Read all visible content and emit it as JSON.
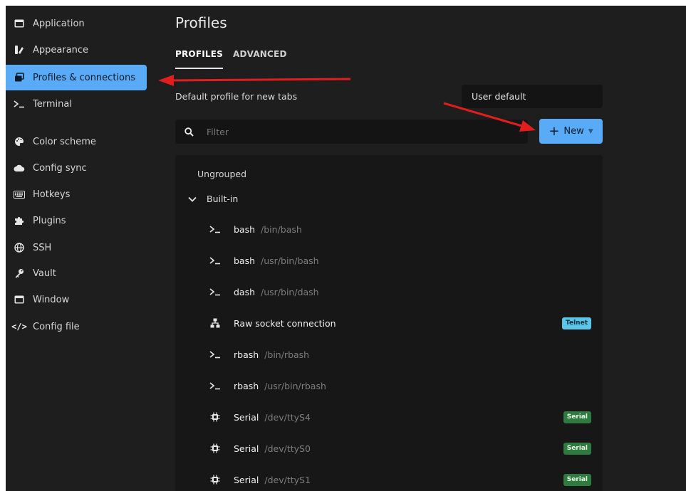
{
  "sidebar": {
    "items": [
      {
        "label": "Application",
        "icon": "window-icon"
      },
      {
        "label": "Appearance",
        "icon": "palette-swatch-icon"
      },
      {
        "label": "Profiles & connections",
        "icon": "window-restore-icon"
      },
      {
        "label": "Terminal",
        "icon": "terminal-icon"
      },
      {
        "label": "Color scheme",
        "icon": "palette-icon"
      },
      {
        "label": "Config sync",
        "icon": "cloud-icon"
      },
      {
        "label": "Hotkeys",
        "icon": "keyboard-icon"
      },
      {
        "label": "Plugins",
        "icon": "puzzle-icon"
      },
      {
        "label": "SSH",
        "icon": "globe-icon"
      },
      {
        "label": "Vault",
        "icon": "key-icon"
      },
      {
        "label": "Window",
        "icon": "window-icon"
      },
      {
        "label": "Config file",
        "icon": "code-icon"
      }
    ],
    "active_index": 2
  },
  "main": {
    "title": "Profiles",
    "tabs": [
      {
        "label": "PROFILES"
      },
      {
        "label": "ADVANCED"
      }
    ],
    "default_profile_label": "Default profile for new tabs",
    "default_profile_value": "User default",
    "filter_placeholder": "Filter",
    "new_button_label": "New",
    "groups": {
      "ungrouped": "Ungrouped",
      "builtin": "Built-in"
    },
    "profiles": [
      {
        "name": "bash",
        "sub": "/bin/bash",
        "icon": "terminal-icon"
      },
      {
        "name": "bash",
        "sub": "/usr/bin/bash",
        "icon": "terminal-icon"
      },
      {
        "name": "dash",
        "sub": "/usr/bin/dash",
        "icon": "terminal-icon"
      },
      {
        "name": "Raw socket connection",
        "sub": "",
        "icon": "network-icon",
        "badge": "Telnet"
      },
      {
        "name": "rbash",
        "sub": "/bin/rbash",
        "icon": "terminal-icon"
      },
      {
        "name": "rbash",
        "sub": "/usr/bin/rbash",
        "icon": "terminal-icon"
      },
      {
        "name": "Serial",
        "sub": "/dev/ttyS4",
        "icon": "chip-icon",
        "badge": "Serial"
      },
      {
        "name": "Serial",
        "sub": "/dev/ttyS0",
        "icon": "chip-icon",
        "badge": "Serial"
      },
      {
        "name": "Serial",
        "sub": "/dev/ttyS1",
        "icon": "chip-icon",
        "badge": "Serial"
      }
    ]
  },
  "colors": {
    "accent": "#59aaf7",
    "annotation_arrow": "#e11d1d",
    "telnet_badge": "#5bc6ea",
    "serial_badge": "#2f7a3f"
  }
}
